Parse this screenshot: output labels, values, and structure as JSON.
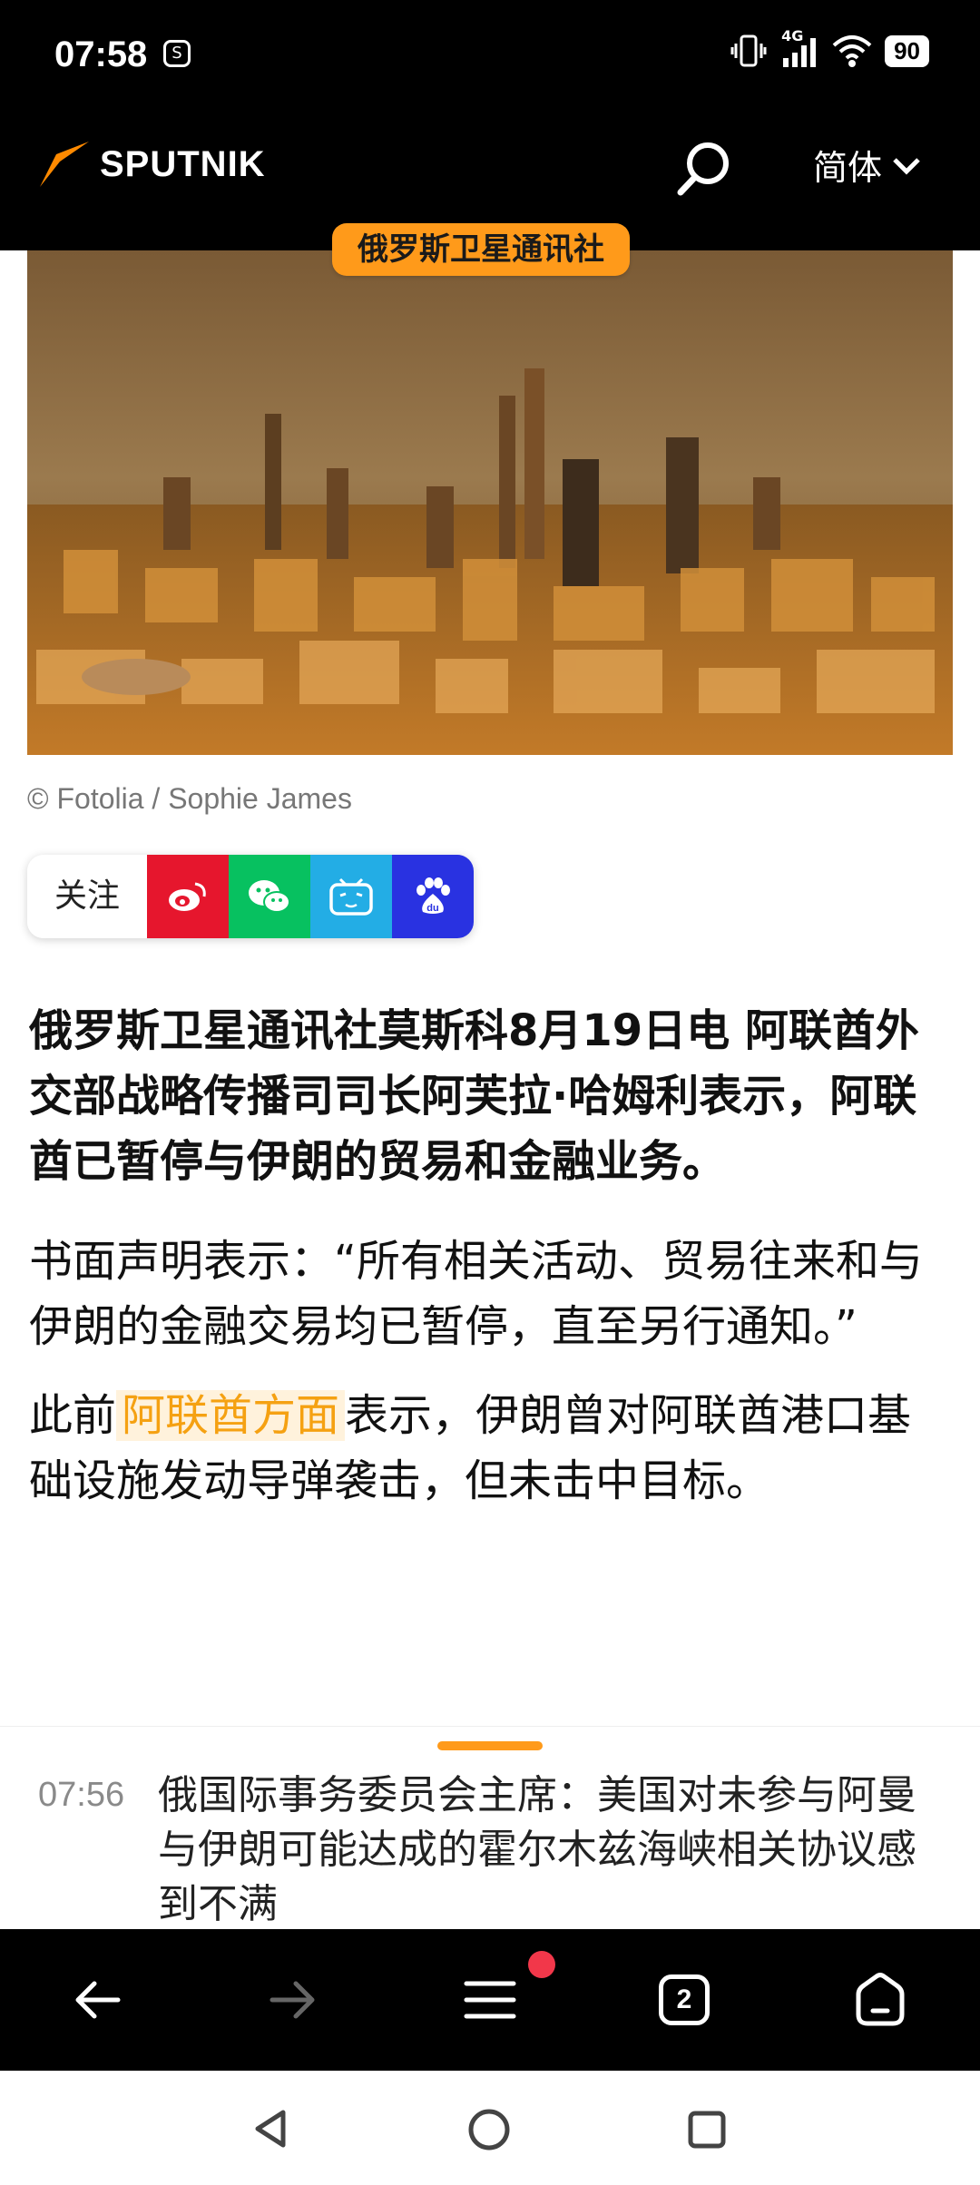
{
  "status": {
    "time": "07:58",
    "sim_label": "S",
    "network": "4G",
    "battery": "90"
  },
  "header": {
    "brand": "SPUTNIK",
    "language": "简体"
  },
  "badge": "俄罗斯卫星通讯社",
  "image": {
    "caption": "© Fotolia / Sophie James"
  },
  "share": {
    "follow_label": "关注",
    "baidu_label": "du"
  },
  "article": {
    "lead": "俄罗斯卫星通讯社莫斯科8月19日电 阿联酋外交部战略传播司司长阿芙拉·哈姆利表示，阿联酋已暂停与伊朗的贸易和金融业务。",
    "para1": "书面声明表示：“所有相关活动、贸易往来和与伊朗的金融交易均已暂停，直至另行通知。”",
    "para2_before": "此前",
    "para2_link": "阿联酋方面",
    "para2_after": "表示，伊朗曾对阿联酋港口基础设施发动导弹袭击，但未击中目标。"
  },
  "feed": {
    "time": "07:56",
    "title": "俄国际事务委员会主席：美国对未参与阿曼与伊朗可能达成的霍尔木兹海峡相关协议感到不满"
  },
  "browser": {
    "tab_count": "2"
  },
  "colors": {
    "accent": "#ff9a1a",
    "weibo": "#e6162d",
    "wechat": "#07c160",
    "bilibili": "#23ade5",
    "baidu": "#2932e1"
  }
}
